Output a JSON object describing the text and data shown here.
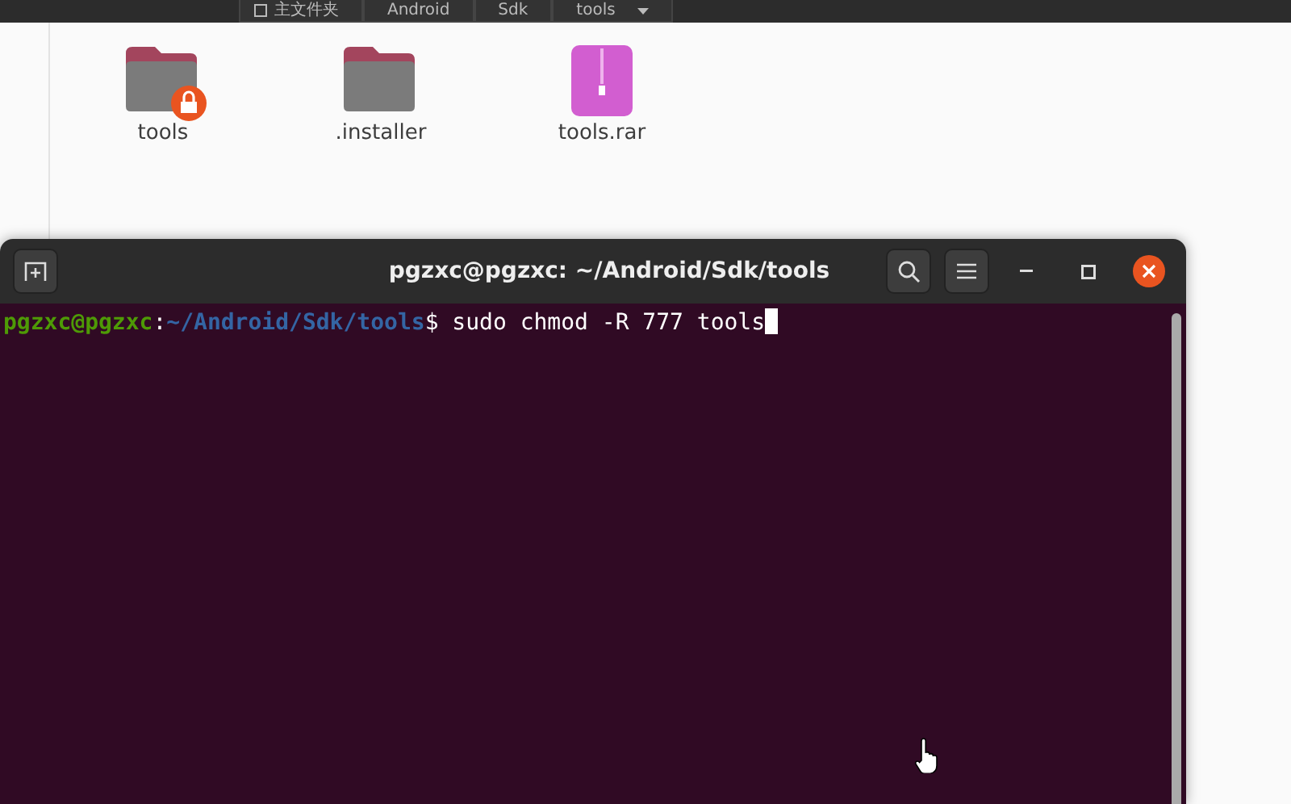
{
  "path_bar": [
    {
      "label": "主文件夹",
      "kind": "home"
    },
    {
      "label": "Android",
      "kind": "plain"
    },
    {
      "label": "Sdk",
      "kind": "plain"
    },
    {
      "label": "tools",
      "kind": "menu"
    }
  ],
  "files": [
    {
      "name": "tools",
      "kind": "folder",
      "locked": true
    },
    {
      "name": ".installer",
      "kind": "folder",
      "locked": false
    },
    {
      "name": "tools.rar",
      "kind": "archive",
      "locked": false
    }
  ],
  "terminal": {
    "title": "pgzxc@pgzxc: ~/Android/Sdk/tools",
    "user_host": "pgzxc@pgzxc",
    "separator": ":",
    "path": "~/Android/Sdk/tools",
    "prompt": "$",
    "command": " sudo chmod -R 777 tools"
  }
}
